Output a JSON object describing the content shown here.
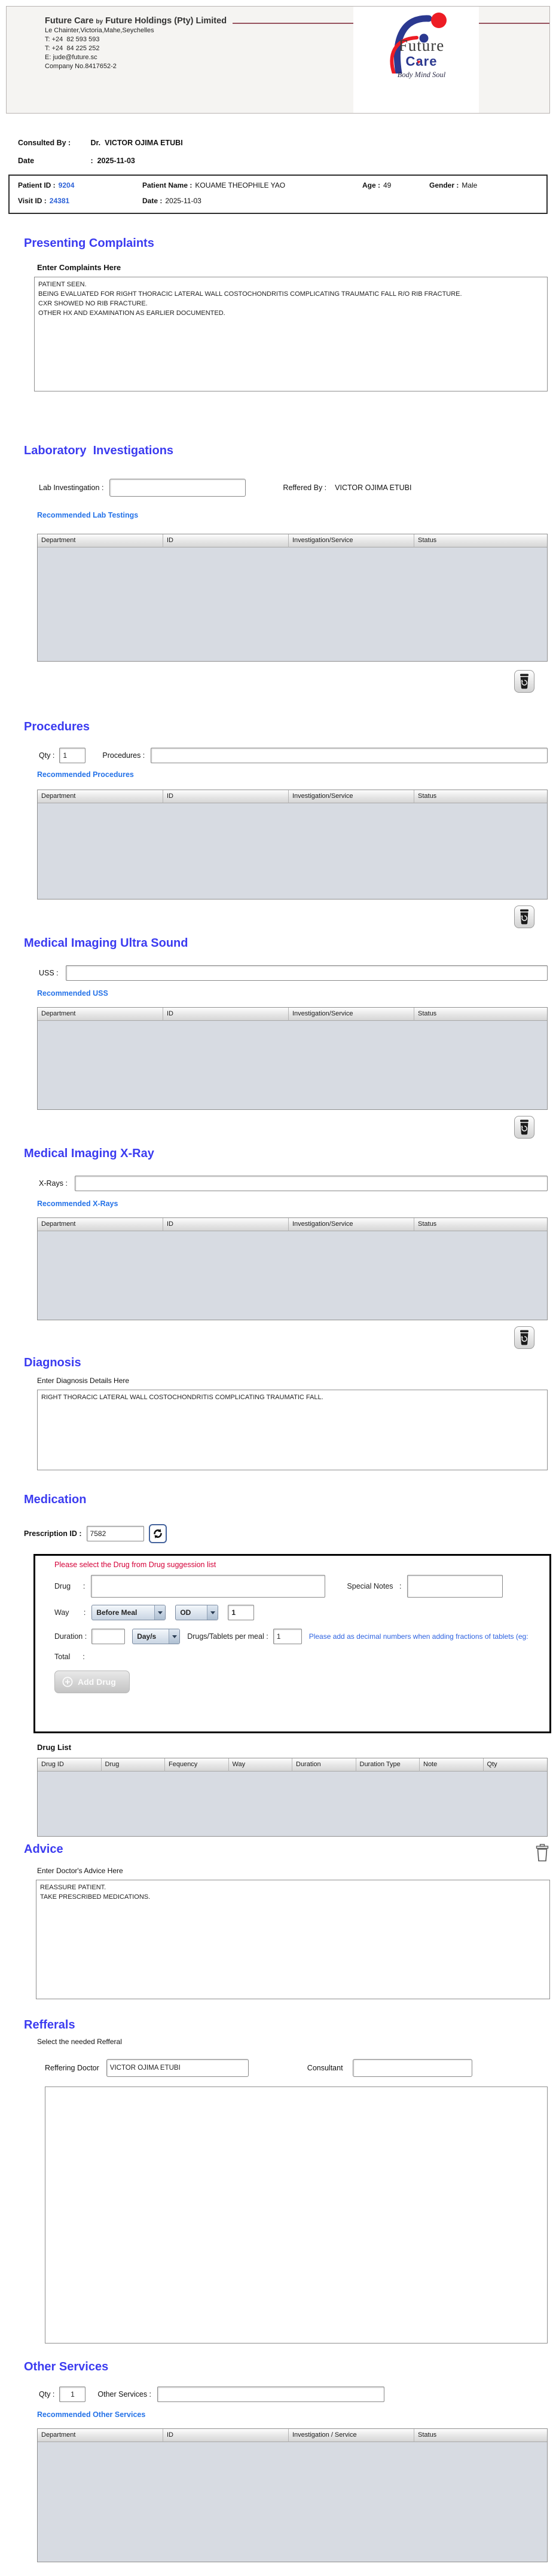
{
  "colors": {
    "section_heading": "#3b3bf0",
    "recommended_link": "#2472e8",
    "id_blue": "#2d62d8",
    "warning_red": "#d40038",
    "hint_blue": "#2d62e0",
    "logo_blue": "#2b3990",
    "logo_red": "#ed1c24",
    "header_rule_maroon": "#96525e",
    "table_body_gray": "#d7dbe2"
  },
  "icons": {
    "trash": "trash-can",
    "refresh": "refresh-arrows",
    "add": "plus-circle",
    "dropdown": "chevron-down",
    "heart": "♥"
  },
  "header": {
    "company_name_1": "Future Care",
    "company_by": "by",
    "company_name_2": "Future Holdings (Pty) Limited",
    "address": "Le Chainter,Victoria,Mahe,Seychelles",
    "phone1": "T: +24  82 593 593",
    "phone2": "T: +24  84 225 252",
    "email": "E: jude@future.sc",
    "company_no": "Company No.8417652-2",
    "logo": {
      "future": "Future",
      "care": "Care",
      "tagline": "Body Mind Soul"
    }
  },
  "consultation": {
    "consulted_by_label": "Consulted By :",
    "consulted_by": "Dr.  VICTOR OJIMA ETUBI",
    "date_label": "Date",
    "date_value": ":  2025-11-03"
  },
  "patient": {
    "patient_id_label": "Patient ID :",
    "patient_id": "9204",
    "patient_name_label": "Patient Name :",
    "patient_name": "KOUAME THEOPHILE YAO",
    "age_label": "Age :",
    "age": "49",
    "gender_label": "Gender :",
    "gender": "Male",
    "visit_id_label": "Visit ID :",
    "visit_id": "24381",
    "visit_date_label": "Date :",
    "visit_date": "2025-11-03"
  },
  "presenting_complaints": {
    "title": "Presenting Complaints",
    "label": "Enter Complaints Here",
    "text": "PATIENT SEEN.\nBEING EVALUATED FOR RIGHT THORACIC LATERAL WALL COSTOCHONDRITIS COMPLICATING TRAUMATIC FALL R/O RIB FRACTURE.\nCXR SHOWED NO RIB FRACTURE.\nOTHER HX AND EXAMINATION AS EARLIER DOCUMENTED."
  },
  "laboratory": {
    "title": "Laboratory  Investigations",
    "lab_label": "Lab Investingation :",
    "referred_by_label": "Reffered By :",
    "referred_by": "VICTOR OJIMA ETUBI",
    "recommended_label": "Recommended Lab Testings",
    "table_headers": [
      "Department",
      "ID",
      "Investigation/Service",
      "Status"
    ]
  },
  "procedures": {
    "title": "Procedures",
    "qty_label": "Qty :",
    "qty_value": "1",
    "procedures_label": "Procedures :",
    "recommended_label": "Recommended Procedures",
    "table_headers": [
      "Department",
      "ID",
      "Investigation/Service",
      "Status"
    ]
  },
  "ultrasound": {
    "title": "Medical Imaging Ultra Sound",
    "uss_label": "USS :",
    "recommended_label": "Recommended USS",
    "table_headers": [
      "Department",
      "ID",
      "Investigation/Service",
      "Status"
    ]
  },
  "xray": {
    "title": "Medical Imaging X-Ray",
    "xrays_label": "X-Rays :",
    "recommended_label": "Recommended X-Rays",
    "table_headers": [
      "Department",
      "ID",
      "Investigation/Service",
      "Status"
    ]
  },
  "diagnosis": {
    "title": "Diagnosis",
    "label": "Enter Diagnosis Details Here",
    "text": "RIGHT THORACIC LATERAL WALL COSTOCHONDRITIS COMPLICATING TRAUMATIC FALL."
  },
  "medication": {
    "title": "Medication",
    "prescription_id_label": "Prescription ID :",
    "prescription_id": "7582",
    "form": {
      "warning": "Please select the Drug from Drug suggession list",
      "drug_label": "Drug      :",
      "special_notes_label": "Special Notes   :",
      "way_label": "Way       :",
      "meal_option": "Before Meal",
      "frequency_option": "OD",
      "way_qty": "1",
      "duration_label": "Duration :",
      "duration_unit": "Day/s",
      "per_meal_label": "Drugs/Tablets per meal :",
      "per_meal_value": "1",
      "hint": "Please add as decimal numbers when adding fractions of tablets (eg:",
      "total_label": "Total      :",
      "add_button": "Add Drug"
    },
    "drug_list_label": "Drug List",
    "drug_table_headers": [
      "Drug ID",
      "Drug",
      "Fequency",
      "Way",
      "Duration",
      "Duration Type",
      "Note",
      "Qty"
    ]
  },
  "advice": {
    "title": "Advice",
    "label": "Enter Doctor's Advice Here",
    "text": "REASSURE PATIENT.\nTAKE PRESCRIBED MEDICATIONS."
  },
  "referrals": {
    "title": "Refferals",
    "subtitle": "Select the needed Refferal",
    "referring_doctor_label": "Reffering Doctor",
    "referring_doctor": "VICTOR OJIMA ETUBI",
    "consultant_label": "Consultant"
  },
  "other_services": {
    "title": "Other Services",
    "qty_label": "Qty :",
    "qty_value": "1",
    "services_label": "Other Services :",
    "recommended_label": "Recommended Other Services",
    "table_headers": [
      "Department",
      "ID",
      "Investigation / Service",
      "Status"
    ]
  }
}
